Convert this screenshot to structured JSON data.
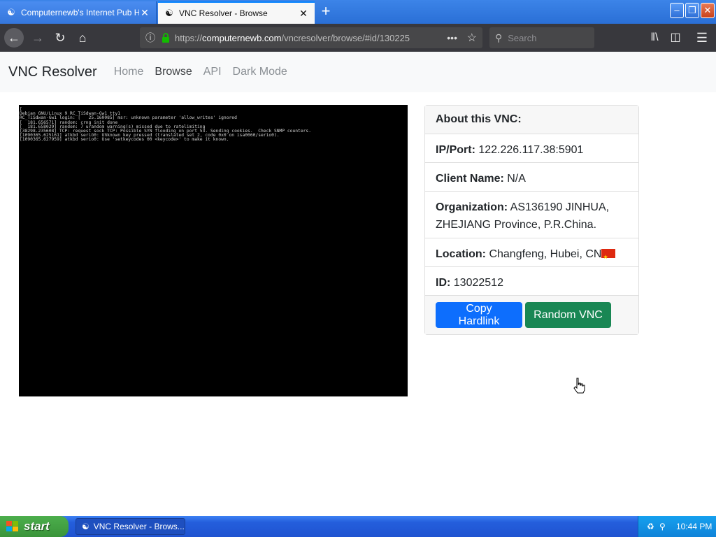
{
  "browser": {
    "tabs": [
      {
        "title": "Computernewb's Internet Pub Hub",
        "active": false
      },
      {
        "title": "VNC Resolver - Browse",
        "active": true
      }
    ],
    "address": {
      "prefix": "https://",
      "domain": "computernewb.com",
      "path": "/vncresolver/browse/#id/130225"
    },
    "search_placeholder": "Search"
  },
  "site": {
    "brand": "VNC Resolver",
    "nav": [
      "Home",
      "Browse",
      "API",
      "Dark Mode"
    ],
    "active_nav": "Browse"
  },
  "screen": {
    "lines": [
      "[",
      "Debian GNU/Linux 9 RC_TiSdwan-Gw1 tty1",
      "",
      "RC_TiSdwan-Gw1 login: [   25.160085] msr: unknown parameter 'allow_writes' ignored",
      "[  181.656571] random: crng init done",
      "[  181.658029] random: 7 urandom warning(s) missed due to ratelimiting",
      "[38298.235608] TCP: request_sock_TCP: Possible SYN flooding on port 53. Sending cookies.  Check SNMP counters.",
      "[1090365.625161] atkbd serio0: Unknown key pressed (translated set 2, code 0x0 on isa0060/serio0).",
      "[1090365.627959] atkbd serio0: Use 'setkeycodes 00 <keycode>' to make it known."
    ]
  },
  "about": {
    "header": "About this VNC:",
    "ipport_label": "IP/Port:",
    "ipport": "122.226.117.38:5901",
    "client_label": "Client Name:",
    "client": "N/A",
    "org_label": "Organization:",
    "org": "AS136190 JINHUA, ZHEJIANG Province, P.R.China.",
    "location_label": "Location:",
    "location": "Changfeng, Hubei, CN",
    "id_label": "ID:",
    "id": "13022512",
    "copy_button": "Copy Hardlink",
    "random_button": "Random VNC"
  },
  "taskbar": {
    "start": "start",
    "item": "VNC Resolver - Brows...",
    "clock": "10:44 PM"
  },
  "colors": {
    "primary": "#0d6efd",
    "success": "#198754",
    "flag_red": "#de2910"
  }
}
